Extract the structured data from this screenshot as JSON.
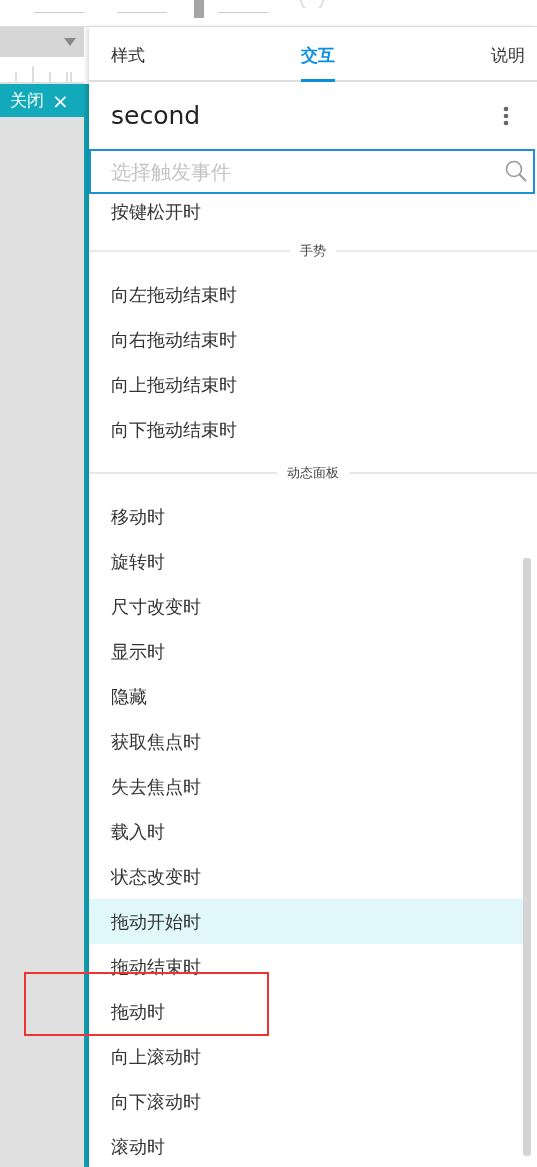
{
  "tabs": [
    {
      "label": "样式",
      "selected": false
    },
    {
      "label": "交互",
      "selected": true
    },
    {
      "label": "说明",
      "selected": false
    }
  ],
  "close_tab": {
    "label": "关闭",
    "icon": "×"
  },
  "widget_name": "second",
  "search": {
    "placeholder": "选择触发事件"
  },
  "event_groups": [
    {
      "items": [
        {
          "label": "按键松开时",
          "selected": false
        }
      ]
    },
    {
      "header": "手势",
      "items": [
        {
          "label": "向左拖动结束时",
          "selected": false
        },
        {
          "label": "向右拖动结束时",
          "selected": false
        },
        {
          "label": "向上拖动结束时",
          "selected": false
        },
        {
          "label": "向下拖动结束时",
          "selected": false
        }
      ]
    },
    {
      "header": "动态面板",
      "items": [
        {
          "label": "移动时",
          "selected": false
        },
        {
          "label": "旋转时",
          "selected": false
        },
        {
          "label": "尺寸改变时",
          "selected": false
        },
        {
          "label": "显示时",
          "selected": false
        },
        {
          "label": "隐藏",
          "selected": false
        },
        {
          "label": "获取焦点时",
          "selected": false
        },
        {
          "label": "失去焦点时",
          "selected": false
        },
        {
          "label": "载入时",
          "selected": false
        },
        {
          "label": "状态改变时",
          "selected": false
        },
        {
          "label": "拖动开始时",
          "selected": true
        },
        {
          "label": "拖动结束时",
          "selected": false
        },
        {
          "label": "拖动时",
          "selected": false
        },
        {
          "label": "向上滚动时",
          "selected": false
        },
        {
          "label": "向下滚动时",
          "selected": false
        },
        {
          "label": "滚动时",
          "selected": false
        }
      ]
    }
  ]
}
